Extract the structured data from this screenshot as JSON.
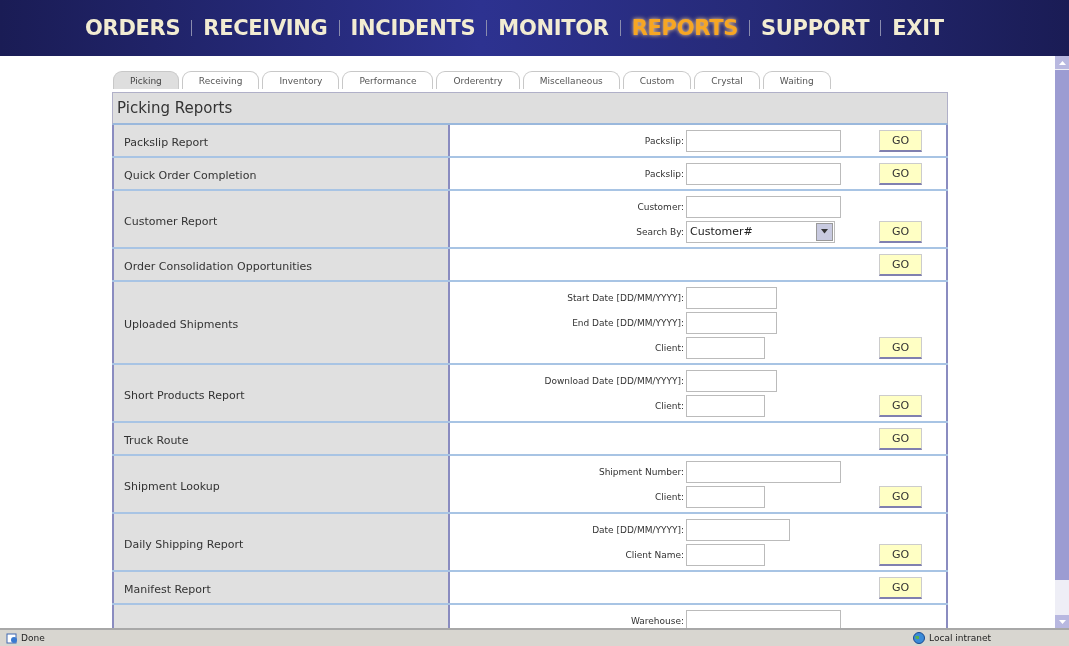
{
  "nav": [
    {
      "label": "ORDERS",
      "selected": false
    },
    {
      "label": "RECEIVING",
      "selected": false
    },
    {
      "label": "INCIDENTS",
      "selected": false
    },
    {
      "label": "MONITOR",
      "selected": false
    },
    {
      "label": "REPORTS",
      "selected": true
    },
    {
      "label": "SUPPORT",
      "selected": false
    },
    {
      "label": "EXIT",
      "selected": false
    }
  ],
  "tabs": [
    {
      "label": "Picking",
      "selected": true
    },
    {
      "label": "Receiving",
      "selected": false
    },
    {
      "label": "Inventory",
      "selected": false
    },
    {
      "label": "Performance",
      "selected": false
    },
    {
      "label": "Orderentry",
      "selected": false
    },
    {
      "label": "Miscellaneous",
      "selected": false
    },
    {
      "label": "Custom",
      "selected": false
    },
    {
      "label": "Crystal",
      "selected": false
    },
    {
      "label": "Waiting",
      "selected": false
    }
  ],
  "section_title": "Picking Reports",
  "reports": [
    {
      "name": "Packslip Report",
      "fields": [
        {
          "kind": "wide",
          "label": "Packslip:"
        }
      ],
      "button": "GO"
    },
    {
      "name": "Quick Order Completion",
      "fields": [
        {
          "kind": "wide",
          "label": "Packslip:"
        }
      ],
      "button": "GO"
    },
    {
      "name": "Customer Report",
      "fields": [
        {
          "kind": "wide",
          "label": "Customer:"
        },
        {
          "kind": "select",
          "label": "Search By:",
          "value": "Customer#"
        }
      ],
      "button": "GO"
    },
    {
      "name": "Order Consolidation Opportunities",
      "button": "GO"
    },
    {
      "name": "Uploaded Shipments",
      "fields": [
        {
          "kind": "medium",
          "label": "Start Date [DD/MM/YYYY]:"
        },
        {
          "kind": "medium",
          "label": "End Date [DD/MM/YYYY]:"
        },
        {
          "kind": "narrow",
          "label": "Client:"
        }
      ],
      "button": "GO"
    },
    {
      "name": "Short Products Report",
      "fields": [
        {
          "kind": "medium",
          "label": "Download Date [DD/MM/YYYY]:"
        },
        {
          "kind": "narrow",
          "label": "Client:"
        }
      ],
      "button": "GO"
    },
    {
      "name": "Truck Route",
      "button": "GO"
    },
    {
      "name": "Shipment Lookup",
      "fields": [
        {
          "kind": "wide",
          "label": "Shipment Number:"
        },
        {
          "kind": "narrow",
          "label": "Client:"
        }
      ],
      "button": "GO"
    },
    {
      "name": "Daily Shipping Report",
      "fields": [
        {
          "kind": "large",
          "label": "Date [DD/MM/YYYY]:"
        },
        {
          "kind": "narrow",
          "label": "Client Name:"
        }
      ],
      "button": "GO"
    },
    {
      "name": "Manifest Report",
      "button": "GO"
    },
    {
      "fields": [
        {
          "kind": "wide",
          "label": "Warehouse:"
        }
      ]
    }
  ],
  "status_bar": {
    "status": "Done",
    "zone": "Local intranet"
  }
}
